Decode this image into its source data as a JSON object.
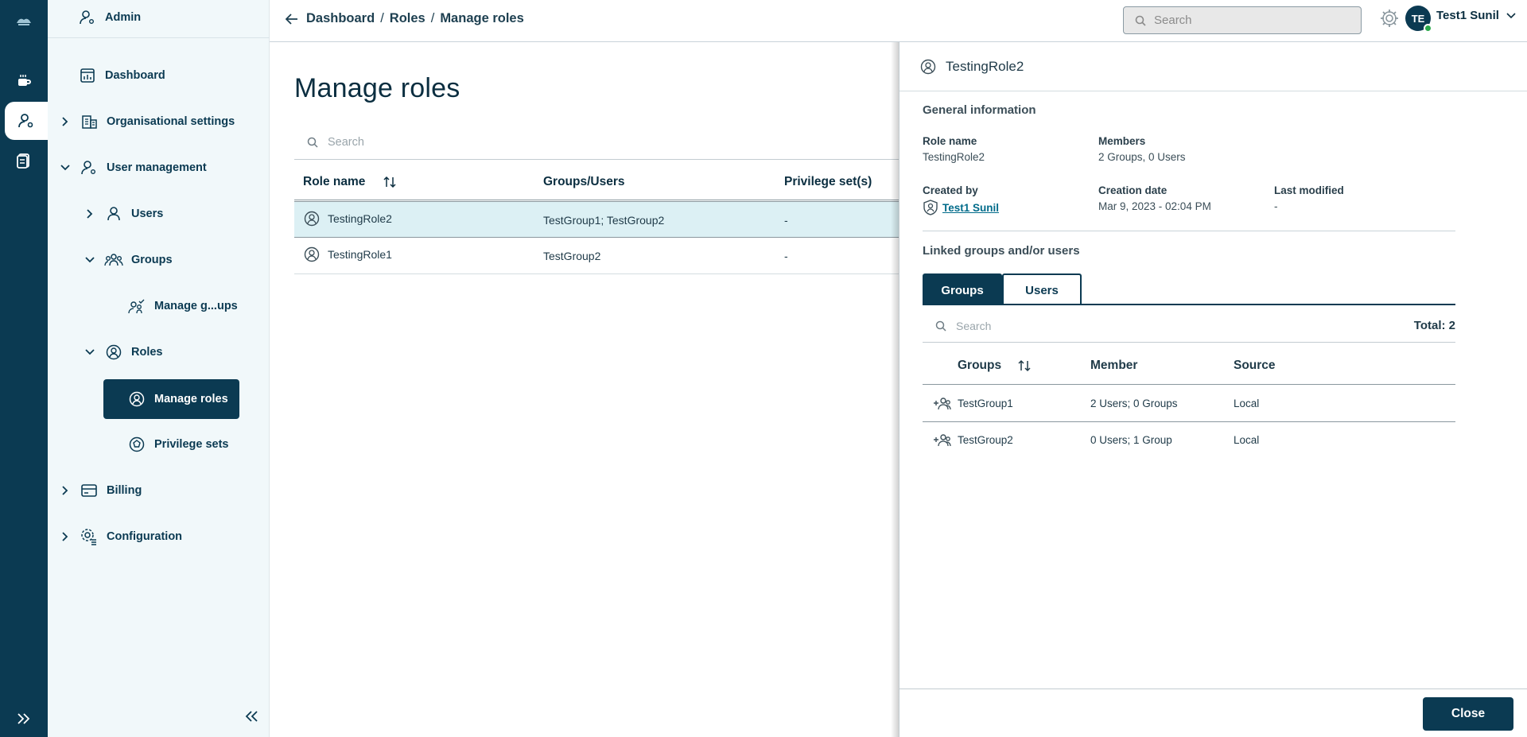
{
  "rail": {
    "icons": [
      "logo-icon",
      "coffee-icon",
      "user-admin-icon",
      "clipboard-icon",
      "expand-icon"
    ]
  },
  "nav": {
    "admin_label": "Admin",
    "items": [
      {
        "label": "Dashboard"
      },
      {
        "label": "Organisational settings"
      },
      {
        "label": "User management"
      },
      {
        "label": "Users"
      },
      {
        "label": "Groups"
      },
      {
        "label": "Manage g...ups"
      },
      {
        "label": "Roles"
      },
      {
        "label": "Manage roles",
        "active": true
      },
      {
        "label": "Privilege sets"
      },
      {
        "label": "Billing"
      },
      {
        "label": "Configuration"
      }
    ]
  },
  "topbar": {
    "breadcrumb": [
      "Dashboard",
      "Roles",
      "Manage roles"
    ],
    "breadcrumb_sep": "/",
    "search_placeholder": "Search",
    "avatar_initials": "TE",
    "user_name": "Test1 Sunil"
  },
  "main": {
    "title": "Manage roles",
    "search_placeholder": "Search",
    "columns": [
      "Role name",
      "Groups/Users",
      "Privilege set(s)"
    ],
    "rows": [
      {
        "name": "TestingRole2",
        "groups": "TestGroup1; TestGroup2",
        "privileges": "-",
        "selected": true
      },
      {
        "name": "TestingRole1",
        "groups": "TestGroup2",
        "privileges": "-",
        "selected": false
      }
    ]
  },
  "panel": {
    "title": "TestingRole2",
    "general_title": "General information",
    "role_name_label": "Role name",
    "role_name_value": "TestingRole2",
    "members_label": "Members",
    "members_value": "2 Groups, 0 Users",
    "created_by_label": "Created by",
    "created_by_value": "Test1 Sunil",
    "creation_date_label": "Creation date",
    "creation_date_value": "Mar 9, 2023 - 02:04 PM",
    "last_modified_label": "Last modified",
    "last_modified_value": "-",
    "linked_title": "Linked groups and/or users",
    "tabs": [
      "Groups",
      "Users"
    ],
    "search_placeholder": "Search",
    "total": "Total: 2",
    "columns": [
      "Groups",
      "Member",
      "Source"
    ],
    "rows": [
      {
        "group": "TestGroup1",
        "member": "2 Users; 0 Groups",
        "source": "Local"
      },
      {
        "group": "TestGroup2",
        "member": "0 Users; 1 Group",
        "source": "Local"
      }
    ],
    "close_label": "Close"
  }
}
